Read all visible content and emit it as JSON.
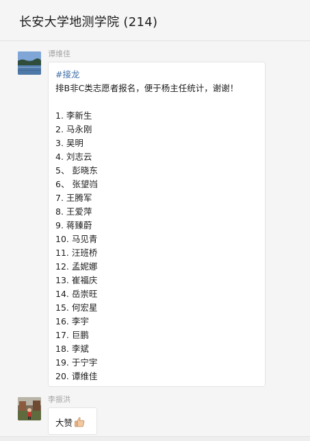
{
  "header": {
    "title": "长安大学地测学院 (214)"
  },
  "messages": [
    {
      "sender": "谭维佳",
      "tag": "#接龙",
      "intro": "排B非C类志愿者报名，便于杨主任统计，谢谢！",
      "list": [
        "1. 李新生",
        "2. 马永刚",
        "3. 吴明",
        "4. 刘志云",
        "5、 彭晓东",
        "6、 张望岿",
        "7. 王腾军",
        "8. 王爱萍",
        "9. 蒋臻蔚",
        "10. 马见青",
        "11. 汪班桥",
        "12. 孟妮娜",
        "13. 崔福庆",
        "14. 岳崇旺",
        "15. 何宏星",
        "16. 李宇",
        "17. 巨鹏",
        "18. 李斌",
        "19. 于宁宇",
        "20. 谭维佳"
      ]
    },
    {
      "sender": "李振洪",
      "text": "大赞",
      "emoji_icon": "thumbs-up-icon"
    }
  ]
}
